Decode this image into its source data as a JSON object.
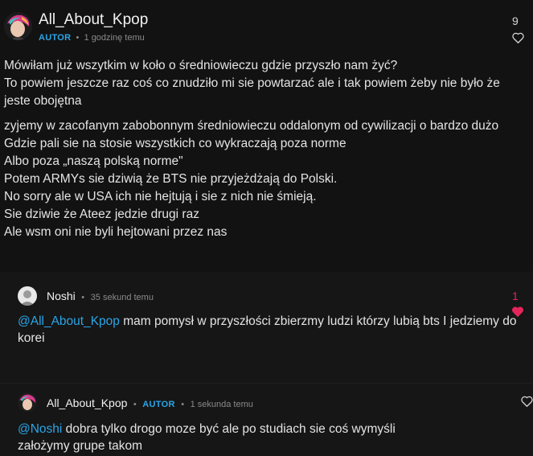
{
  "main_comment": {
    "author": "All_About_Kpop",
    "badge": "AUTOR",
    "time": "1 godzinę temu",
    "like_count": "9",
    "para1": [
      "Mówiłam już wszytkim w koło o średniowieczu gdzie przyszło nam żyć?",
      "To powiem jeszcze raz coś co znudziło mi sie powtarzać ale i tak powiem żeby nie było że",
      "jeste obojętna"
    ],
    "para2": [
      "zyjemy w zacofanym zabobonnym średniowieczu oddalonym od cywilizacji o bardzo dużo",
      "Gdzie pali sie na stosie wszystkich co wykraczają poza norme",
      "Albo poza „naszą polską norme\"",
      "Potem ARMYs sie dziwią że BTS nie przyjeżdżają do Polski.",
      "No sorry ale w USA ich nie hejtują i sie z nich nie śmieją.",
      "Sie dziwie że Ateez jedzie drugi raz",
      "Ale wsm oni nie byli hejtowani przez nas"
    ]
  },
  "reply1": {
    "author": "Noshi",
    "time": "35 sekund temu",
    "like_count": "1",
    "mention": "@All_About_Kpop",
    "line1_rest": " mam pomysł w przyszłości zbierzmy ludzi którzy lubią bts I jedziemy do",
    "line2": "korei"
  },
  "reply2": {
    "author": "All_About_Kpop",
    "badge": "AUTOR",
    "time": "1 sekunda temu",
    "mention": "@Noshi",
    "line1_rest": " dobra tylko drogo moze być ale po studiach sie coś wymyśli",
    "line2": "założymy grupe takom"
  },
  "colors": {
    "background": "#121212",
    "accent_blue": "#2aa5e8",
    "like_red": "#e3265b"
  }
}
